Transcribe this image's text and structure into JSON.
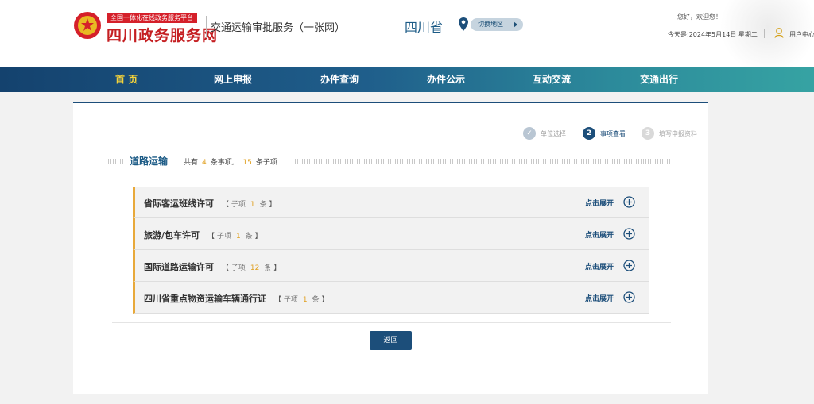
{
  "header": {
    "slogan": "全国一体化在线政务服务平台",
    "site_name": "四川政务服务网",
    "service_name": "交通运输审批服务（一张网）",
    "province": "四川省",
    "switch_region": "切换地区",
    "welcome": "您好，欢迎您！",
    "date": "今天是:2024年5月14日 星期二",
    "user_center": "用户中心"
  },
  "nav": {
    "items": [
      {
        "label": "首 页",
        "active": true
      },
      {
        "label": "网上申报"
      },
      {
        "label": "办件查询"
      },
      {
        "label": "办件公示"
      },
      {
        "label": "互动交流"
      },
      {
        "label": "交通出行"
      }
    ]
  },
  "steps": [
    {
      "num": "✓",
      "label": "单位选择",
      "state": "done"
    },
    {
      "num": "2",
      "label": "事项查看",
      "state": "current"
    },
    {
      "num": "3",
      "label": "填写申报资料",
      "state": "todo"
    }
  ],
  "section": {
    "title": "道路运输",
    "summary_prefix": "共有",
    "item_count": "4",
    "item_unit": "条事项,",
    "sub_count": "15",
    "sub_unit": "条子项"
  },
  "items": [
    {
      "name": "省际客运班线许可",
      "sub_label": "子项",
      "sub_count": "1",
      "unit": "条",
      "expand": "点击展开"
    },
    {
      "name": "旅游/包车许可",
      "sub_label": "子项",
      "sub_count": "1",
      "unit": "条",
      "expand": "点击展开"
    },
    {
      "name": "国际道路运输许可",
      "sub_label": "子项",
      "sub_count": "12",
      "unit": "条",
      "expand": "点击展开"
    },
    {
      "name": "四川省重点物资运输车辆通行证",
      "sub_label": "子项",
      "sub_count": "1",
      "unit": "条",
      "expand": "点击展开"
    }
  ],
  "back_button": "返回",
  "colors": {
    "primary": "#1c4e7a",
    "accent": "#e8a93b",
    "brand_red": "#c51f22",
    "nav_active": "#f5d33a"
  }
}
